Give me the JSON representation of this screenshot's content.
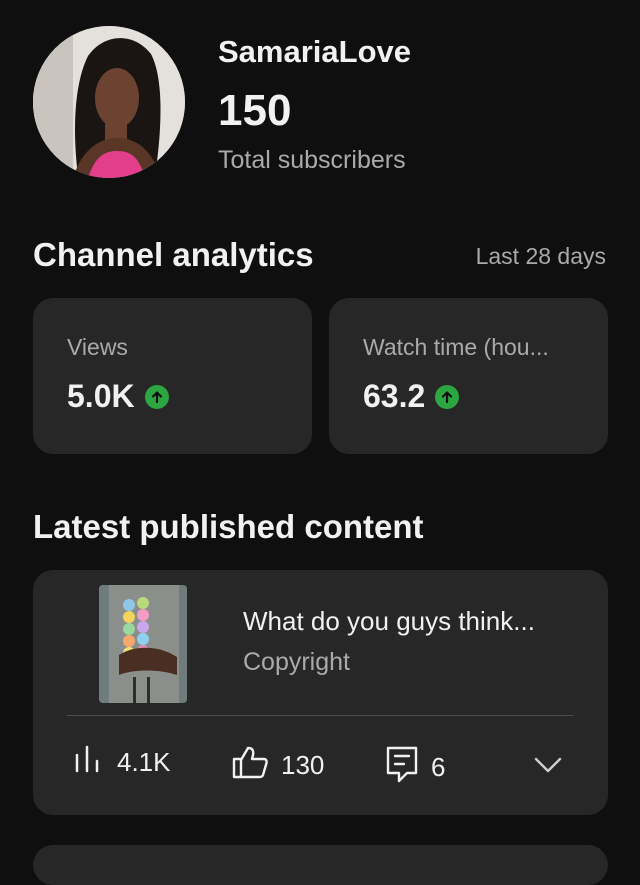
{
  "profile": {
    "channel_name": "SamariaLove",
    "subscriber_count": "150",
    "subscriber_label": "Total subscribers"
  },
  "analytics": {
    "title": "Channel analytics",
    "period": "Last 28 days",
    "metrics": [
      {
        "label": "Views",
        "value": "5.0K",
        "trend": "up"
      },
      {
        "label": "Watch time (hou...",
        "value": "63.2",
        "trend": "up"
      }
    ]
  },
  "latest": {
    "title": "Latest published content",
    "video": {
      "title": "What do you guys think...",
      "subtitle": "Copyright",
      "views": "4.1K",
      "likes": "130",
      "comments": "6"
    }
  },
  "icons": {
    "trend_up": "arrow-up-icon",
    "views": "bar-chart-icon",
    "likes": "thumbs-up-icon",
    "comments": "comment-icon",
    "expand": "chevron-down-icon"
  },
  "colors": {
    "background": "#0f0f0f",
    "card": "#272727",
    "trend_up": "#2ba640",
    "secondary_text": "#aaaaaa"
  }
}
